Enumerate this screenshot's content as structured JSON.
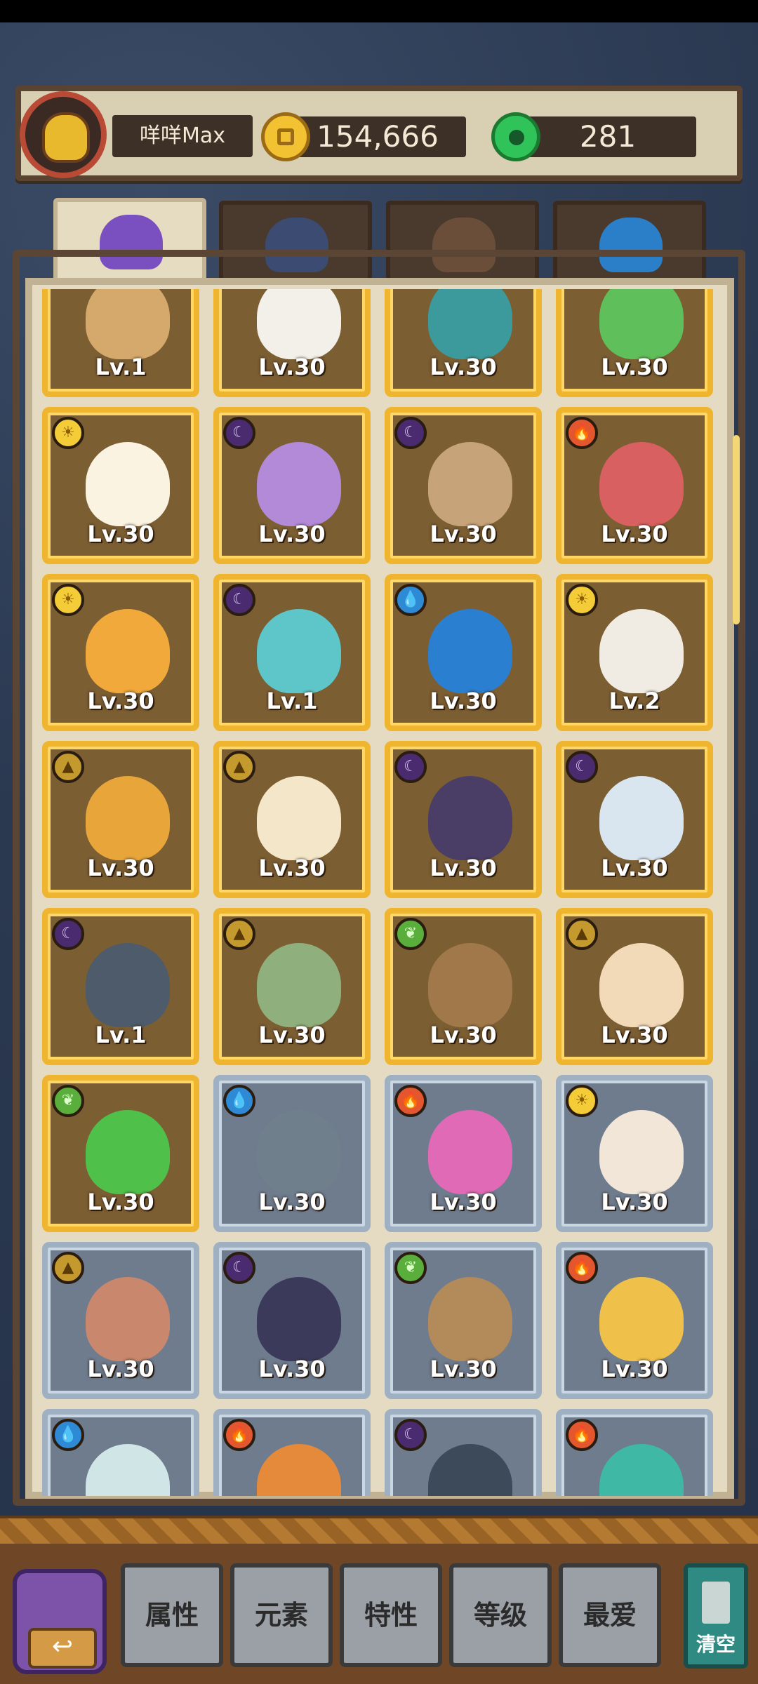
{
  "header": {
    "player_name": "咩咩Max",
    "coins": "154,666",
    "gems": "281"
  },
  "tabs": [
    {
      "icon": "monster-tab-icon",
      "active": true
    },
    {
      "icon": "equipment-tab-icon",
      "active": false
    },
    {
      "icon": "food-tab-icon",
      "active": false
    },
    {
      "icon": "crystal-tab-icon",
      "active": false
    }
  ],
  "cards": [
    {
      "level": "Lv.1",
      "element": "",
      "frame": "gold",
      "color": "#d5a86b"
    },
    {
      "level": "Lv.30",
      "element": "",
      "frame": "gold",
      "color": "#f3f0ea"
    },
    {
      "level": "Lv.30",
      "element": "",
      "frame": "gold",
      "color": "#3c9a9c"
    },
    {
      "level": "Lv.30",
      "element": "",
      "frame": "gold",
      "color": "#5fbf5a"
    },
    {
      "level": "Lv.30",
      "element": "light",
      "frame": "gold",
      "color": "#fbf3e2"
    },
    {
      "level": "Lv.30",
      "element": "dark",
      "frame": "gold",
      "color": "#b38ad8"
    },
    {
      "level": "Lv.30",
      "element": "dark",
      "frame": "gold",
      "color": "#c7a37a"
    },
    {
      "level": "Lv.30",
      "element": "fire",
      "frame": "gold",
      "color": "#d96060"
    },
    {
      "level": "Lv.30",
      "element": "light",
      "frame": "gold",
      "color": "#f0a93a"
    },
    {
      "level": "Lv.1",
      "element": "dark",
      "frame": "gold",
      "color": "#5ec6c9"
    },
    {
      "level": "Lv.30",
      "element": "water",
      "frame": "gold",
      "color": "#2b7fd1"
    },
    {
      "level": "Lv.2",
      "element": "light",
      "frame": "gold",
      "color": "#f0ece4"
    },
    {
      "level": "Lv.30",
      "element": "earth",
      "frame": "gold",
      "color": "#e8a63a"
    },
    {
      "level": "Lv.30",
      "element": "earth",
      "frame": "gold",
      "color": "#f4e7c9"
    },
    {
      "level": "Lv.30",
      "element": "dark",
      "frame": "gold",
      "color": "#4a3d66"
    },
    {
      "level": "Lv.30",
      "element": "dark",
      "frame": "gold",
      "color": "#d9e6f0"
    },
    {
      "level": "Lv.1",
      "element": "dark",
      "frame": "gold",
      "color": "#4d5b6a"
    },
    {
      "level": "Lv.30",
      "element": "earth",
      "frame": "gold",
      "color": "#8fb07c"
    },
    {
      "level": "Lv.30",
      "element": "wood",
      "frame": "gold",
      "color": "#a0784a"
    },
    {
      "level": "Lv.30",
      "element": "earth",
      "frame": "gold",
      "color": "#f2d9b8"
    },
    {
      "level": "Lv.30",
      "element": "wood",
      "frame": "gold",
      "color": "#4fc04a"
    },
    {
      "level": "Lv.30",
      "element": "water",
      "frame": "silver",
      "color": "#6f7f8c"
    },
    {
      "level": "Lv.30",
      "element": "fire",
      "frame": "silver",
      "color": "#e06ab6"
    },
    {
      "level": "Lv.30",
      "element": "light",
      "frame": "silver",
      "color": "#f2e6d8"
    },
    {
      "level": "Lv.30",
      "element": "earth",
      "frame": "silver",
      "color": "#c9876d"
    },
    {
      "level": "Lv.30",
      "element": "dark",
      "frame": "silver",
      "color": "#3c3a5a"
    },
    {
      "level": "Lv.30",
      "element": "wood",
      "frame": "silver",
      "color": "#b38a5a"
    },
    {
      "level": "Lv.30",
      "element": "fire",
      "frame": "silver",
      "color": "#f0c14a"
    },
    {
      "level": "",
      "element": "water",
      "frame": "silver",
      "color": "#d0e6e6"
    },
    {
      "level": "",
      "element": "fire",
      "frame": "silver",
      "color": "#e48a3a"
    },
    {
      "level": "",
      "element": "dark",
      "frame": "silver",
      "color": "#3c4a5a"
    },
    {
      "level": "",
      "element": "fire",
      "frame": "silver",
      "color": "#3fb8a6"
    }
  ],
  "element_glyphs": {
    "light": "☀",
    "dark": "☾",
    "fire": "🔥",
    "water": "💧",
    "earth": "▲",
    "wood": "❦"
  },
  "filters": {
    "attribute": "属性",
    "element": "元素",
    "trait": "特性",
    "level": "等级",
    "favorite": "最爱"
  },
  "clear_label": "清空",
  "back_glyph": "↩"
}
